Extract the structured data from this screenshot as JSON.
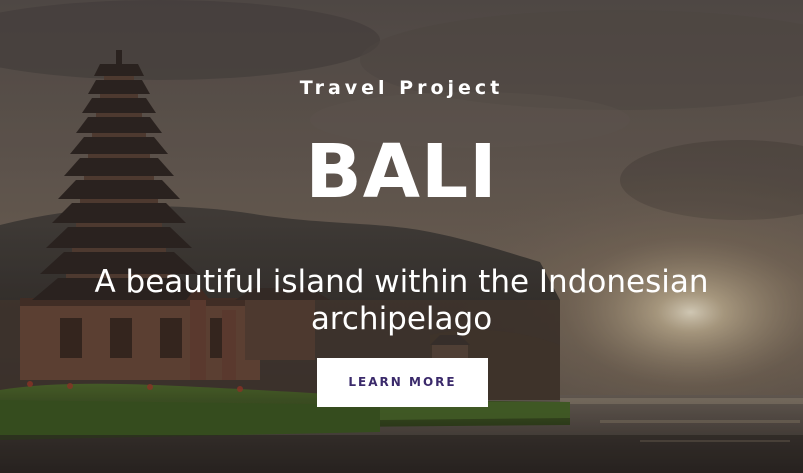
{
  "hero": {
    "eyebrow": "Travel Project",
    "title": "BALI",
    "tagline": "A beautiful island within the Indonesian archipelago",
    "cta_label": "LEARN MORE"
  },
  "colors": {
    "text": "#ffffff",
    "button_bg": "#ffffff",
    "button_text": "#3b2a6b"
  },
  "background": {
    "subject": "temple-pagoda-on-lake-at-sunset"
  }
}
